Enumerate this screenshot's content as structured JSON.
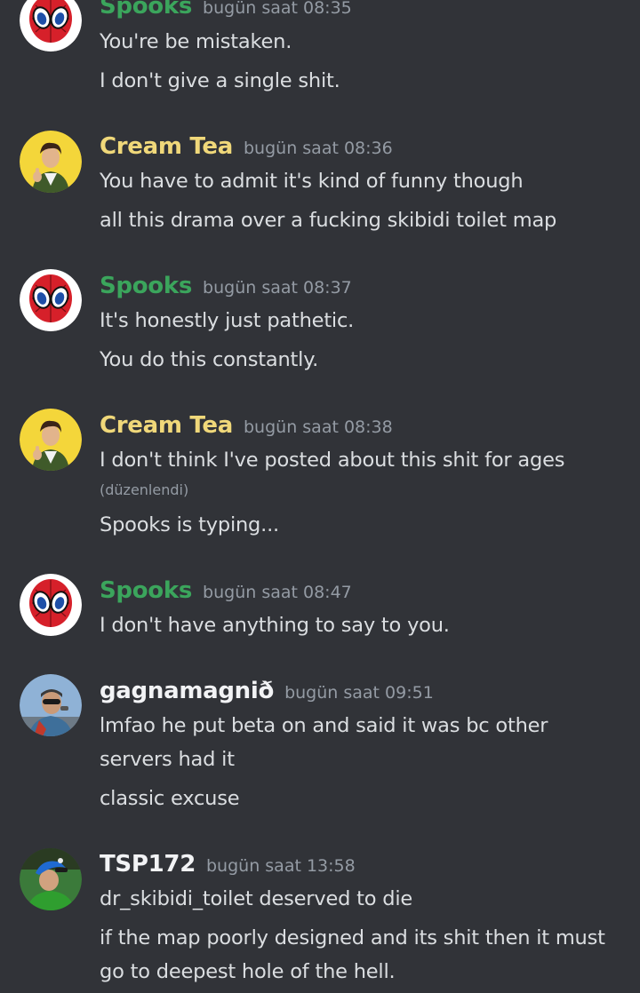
{
  "colors": {
    "background": "#313338",
    "spooks_name": "#3ba55c",
    "creamtea_name": "#f0d87a",
    "default_name": "#f2f3f5",
    "timestamp": "#949ba4",
    "text": "#dbdee1"
  },
  "messages": [
    {
      "author": "Spooks",
      "time": "bugün saat 08:35",
      "avatar": "spiderman-balloon-avatar",
      "lines": [
        "You're be mistaken.",
        "I don't give a single shit."
      ]
    },
    {
      "author": "Cream Tea",
      "time": "bugün saat 08:36",
      "avatar": "man-thumbs-up-avatar",
      "lines": [
        "You have to admit it's kind of funny though",
        "all this drama over a fucking skibidi toilet map"
      ]
    },
    {
      "author": "Spooks",
      "time": "bugün saat 08:37",
      "avatar": "spiderman-balloon-avatar",
      "lines": [
        "It's honestly just pathetic.",
        "You do this constantly."
      ]
    },
    {
      "author": "Cream Tea",
      "time": "bugün saat 08:38",
      "avatar": "man-thumbs-up-avatar",
      "lines": [
        "I don't think I've posted about this shit for ages",
        "Spooks is typing..."
      ],
      "edited": "(düzenlendi)"
    },
    {
      "author": "Spooks",
      "time": "bugün saat 08:47",
      "avatar": "spiderman-balloon-avatar",
      "lines": [
        "I don't have anything to say to you."
      ]
    },
    {
      "author": "gagnamagnið",
      "time": "bugün saat 09:51",
      "avatar": "man-sunglasses-avatar",
      "lines": [
        "lmfao he put beta on and said it was bc other",
        "servers had it",
        "classic excuse"
      ]
    },
    {
      "author": "TSP172",
      "time": "bugün saat 13:58",
      "avatar": "man-green-hat-avatar",
      "lines": [
        "dr_skibidi_toilet deserved to die",
        "if the map poorly designed and its shit then it must",
        "go to deepest hole of the hell."
      ]
    }
  ]
}
